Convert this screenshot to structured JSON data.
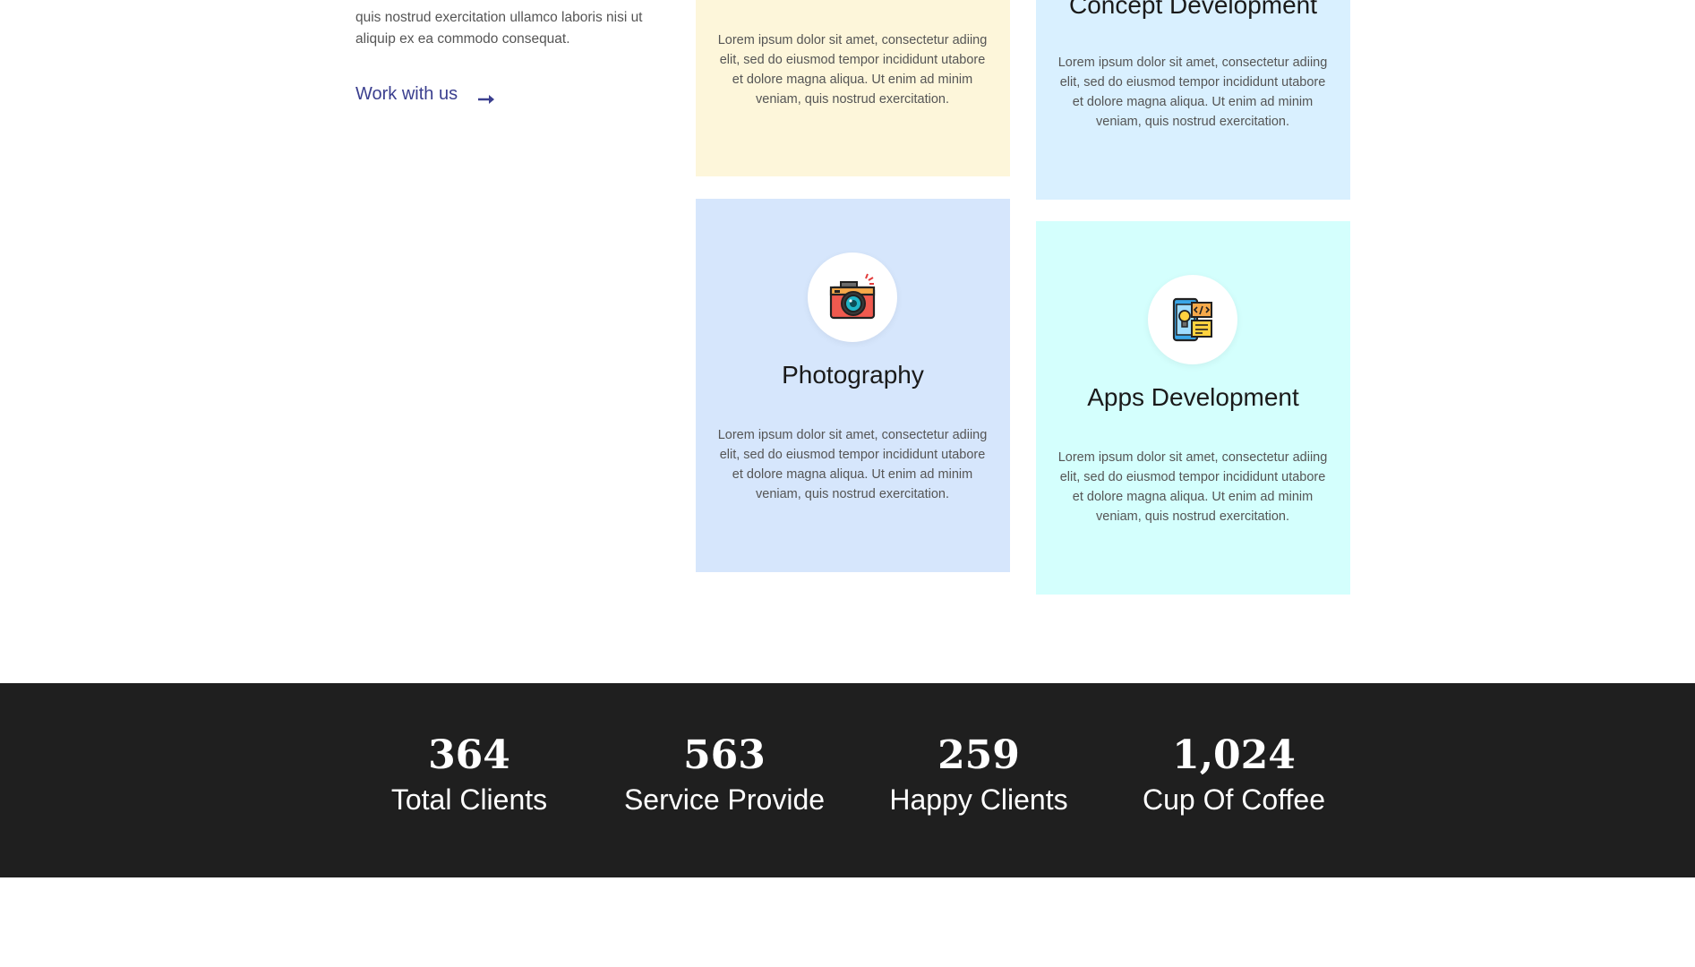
{
  "intro": {
    "text": "quis nostrud exercitation ullamco laboris nisi ut aliquip ex ea commodo consequat.",
    "link_label": "Work with us",
    "link_icon": "arrow-right-icon",
    "accent_color": "#3b3f8f"
  },
  "services": {
    "design": {
      "text": "Lorem ipsum dolor sit amet, consectetur adiing elit, sed do eiusmod tempor incididunt utabore et dolore magna aliqua. Ut enim ad minim veniam, quis nostrud exercitation.",
      "background": "#fdf6da"
    },
    "concept": {
      "title": "Concept Development",
      "text": "Lorem ipsum dolor sit amet, consectetur adiing elit, sed do eiusmod tempor incididunt utabore et dolore magna aliqua. Ut enim ad minim veniam, quis nostrud exercitation.",
      "background": "#d9f0ff"
    },
    "photography": {
      "title": "Photography",
      "icon": "camera-icon",
      "text": "Lorem ipsum dolor sit amet, consectetur adiing elit, sed do eiusmod tempor incididunt utabore et dolore magna aliqua. Ut enim ad minim veniam, quis nostrud exercitation.",
      "background": "#d6e6fc"
    },
    "apps": {
      "title": "Apps Development",
      "icon": "app-development-icon",
      "text": "Lorem ipsum dolor sit amet, consectetur adiing elit, sed do eiusmod tempor incididunt utabore et dolore magna aliqua. Ut enim ad minim veniam, quis nostrud exercitation.",
      "background": "#d4fffd"
    }
  },
  "stats": [
    {
      "number": "364",
      "label": "Total Clients"
    },
    {
      "number": "563",
      "label": "Service Provide"
    },
    {
      "number": "259",
      "label": "Happy Clients"
    },
    {
      "number": "1,024",
      "label": "Cup Of Coffee"
    }
  ],
  "stats_background": "#1f1f1f"
}
